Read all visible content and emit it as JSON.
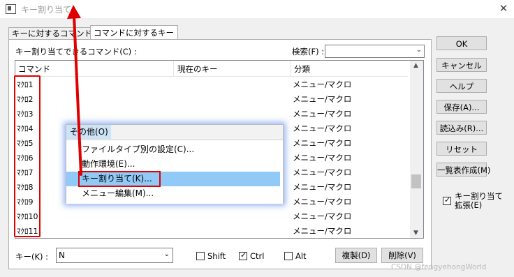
{
  "window": {
    "title": "キー割り当て",
    "close": "✕"
  },
  "tabs": [
    {
      "label": "キーに対するコマンド"
    },
    {
      "label": "コマンドに対するキー"
    }
  ],
  "commands_label": "キー割り当てできるコマンド(C) :",
  "search": {
    "label": "検索(F) :",
    "value": ""
  },
  "table": {
    "headers": [
      "コマンド",
      "現在のキー",
      "分類"
    ],
    "rows": [
      {
        "command": "ﾏｸﾛ1",
        "key": "",
        "category": "メニュー/マクロ"
      },
      {
        "command": "ﾏｸﾛ2",
        "key": "",
        "category": "メニュー/マクロ"
      },
      {
        "command": "ﾏｸﾛ3",
        "key": "",
        "category": "メニュー/マクロ"
      },
      {
        "command": "ﾏｸﾛ4",
        "key": "",
        "category": "メニュー/マクロ"
      },
      {
        "command": "ﾏｸﾛ5",
        "key": "",
        "category": "メニュー/マクロ"
      },
      {
        "command": "ﾏｸﾛ6",
        "key": "",
        "category": "メニュー/マクロ"
      },
      {
        "command": "ﾏｸﾛ7",
        "key": "",
        "category": "メニュー/マクロ"
      },
      {
        "command": "ﾏｸﾛ8",
        "key": "",
        "category": "メニュー/マクロ"
      },
      {
        "command": "ﾏｸﾛ9",
        "key": "",
        "category": "メニュー/マクロ"
      },
      {
        "command": "ﾏｸﾛ10",
        "key": "",
        "category": "メニュー/マクロ"
      },
      {
        "command": "ﾏｸﾛ11",
        "key": "",
        "category": "メニュー/マクロ"
      }
    ]
  },
  "popup": {
    "header": "その他(O)",
    "items": [
      "ファイルタイプ別の設定(C)...",
      "動作環境(E)...",
      "キー割り当て(K)...",
      "メニュー編集(M)..."
    ]
  },
  "buttons": [
    "OK",
    "キャンセル",
    "ヘルプ",
    "保存(A)...",
    "読込み(R)...",
    "リセット",
    "一覧表作成(M)"
  ],
  "extend": {
    "label_line1": "キー割り当て",
    "label_line2": "拡張(E)",
    "checked": true
  },
  "bottom": {
    "key_label": "キー(K) :",
    "key_value": "N",
    "shift": {
      "label": "Shift",
      "checked": false
    },
    "ctrl": {
      "label": "Ctrl",
      "checked": true
    },
    "alt": {
      "label": "Alt",
      "checked": false
    },
    "copy_button": "複製(D)",
    "delete_button": "削除(V)"
  },
  "watermark": "CSDN @fengyehongWorld",
  "colors": {
    "highlight": "#91c9f7",
    "annotation_red": "#e00000"
  }
}
